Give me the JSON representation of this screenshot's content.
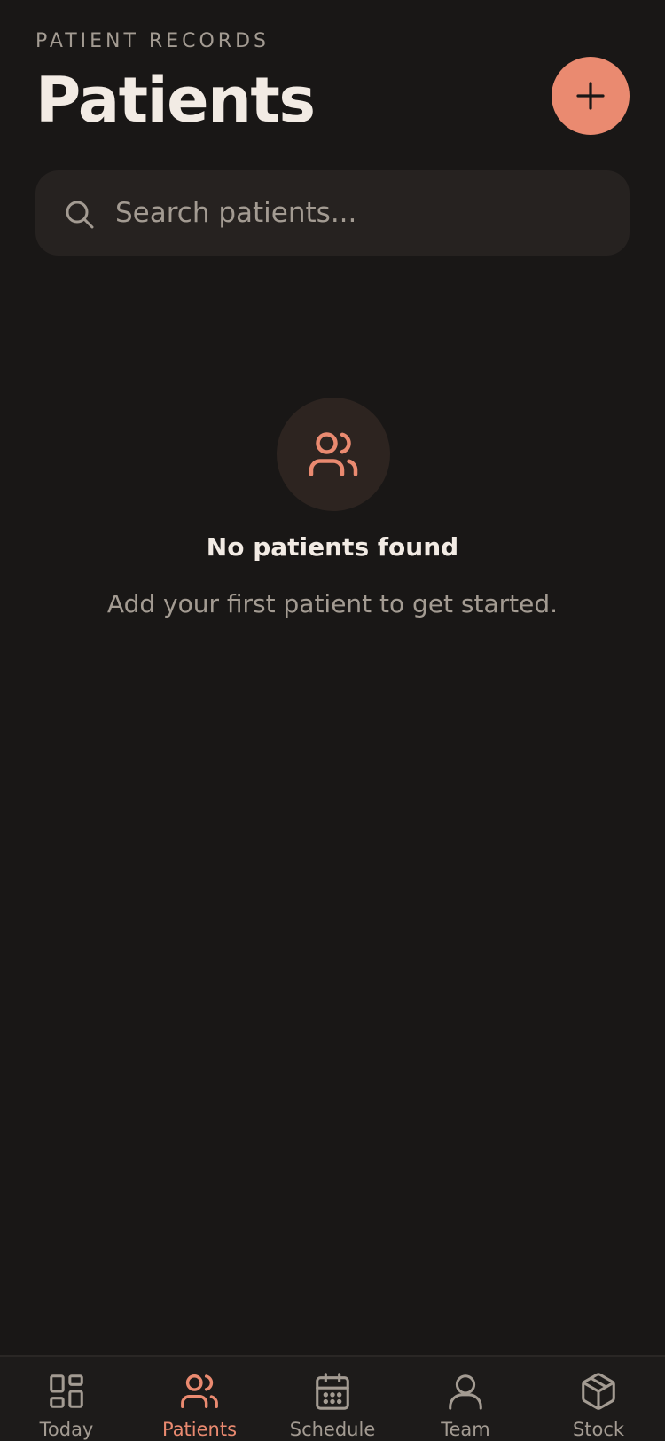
{
  "header": {
    "eyebrow": "PATIENT RECORDS",
    "title": "Patients",
    "add_icon": "plus-icon"
  },
  "search": {
    "placeholder": "Search patients...",
    "value": "",
    "icon": "search-icon"
  },
  "empty_state": {
    "icon": "users-icon",
    "title": "No patients found",
    "subtitle": "Add your first patient to get started."
  },
  "tabbar": {
    "active": "Patients",
    "items": [
      {
        "label": "Today",
        "icon": "grid-icon"
      },
      {
        "label": "Patients",
        "icon": "users-icon"
      },
      {
        "label": "Schedule",
        "icon": "calendar-icon"
      },
      {
        "label": "Team",
        "icon": "user-icon"
      },
      {
        "label": "Stock",
        "icon": "box-icon"
      }
    ]
  },
  "colors": {
    "background": "#191716",
    "accent": "#ea8a70",
    "text": "#f2ebe4",
    "muted": "#a39b92",
    "surface": "#262220"
  }
}
